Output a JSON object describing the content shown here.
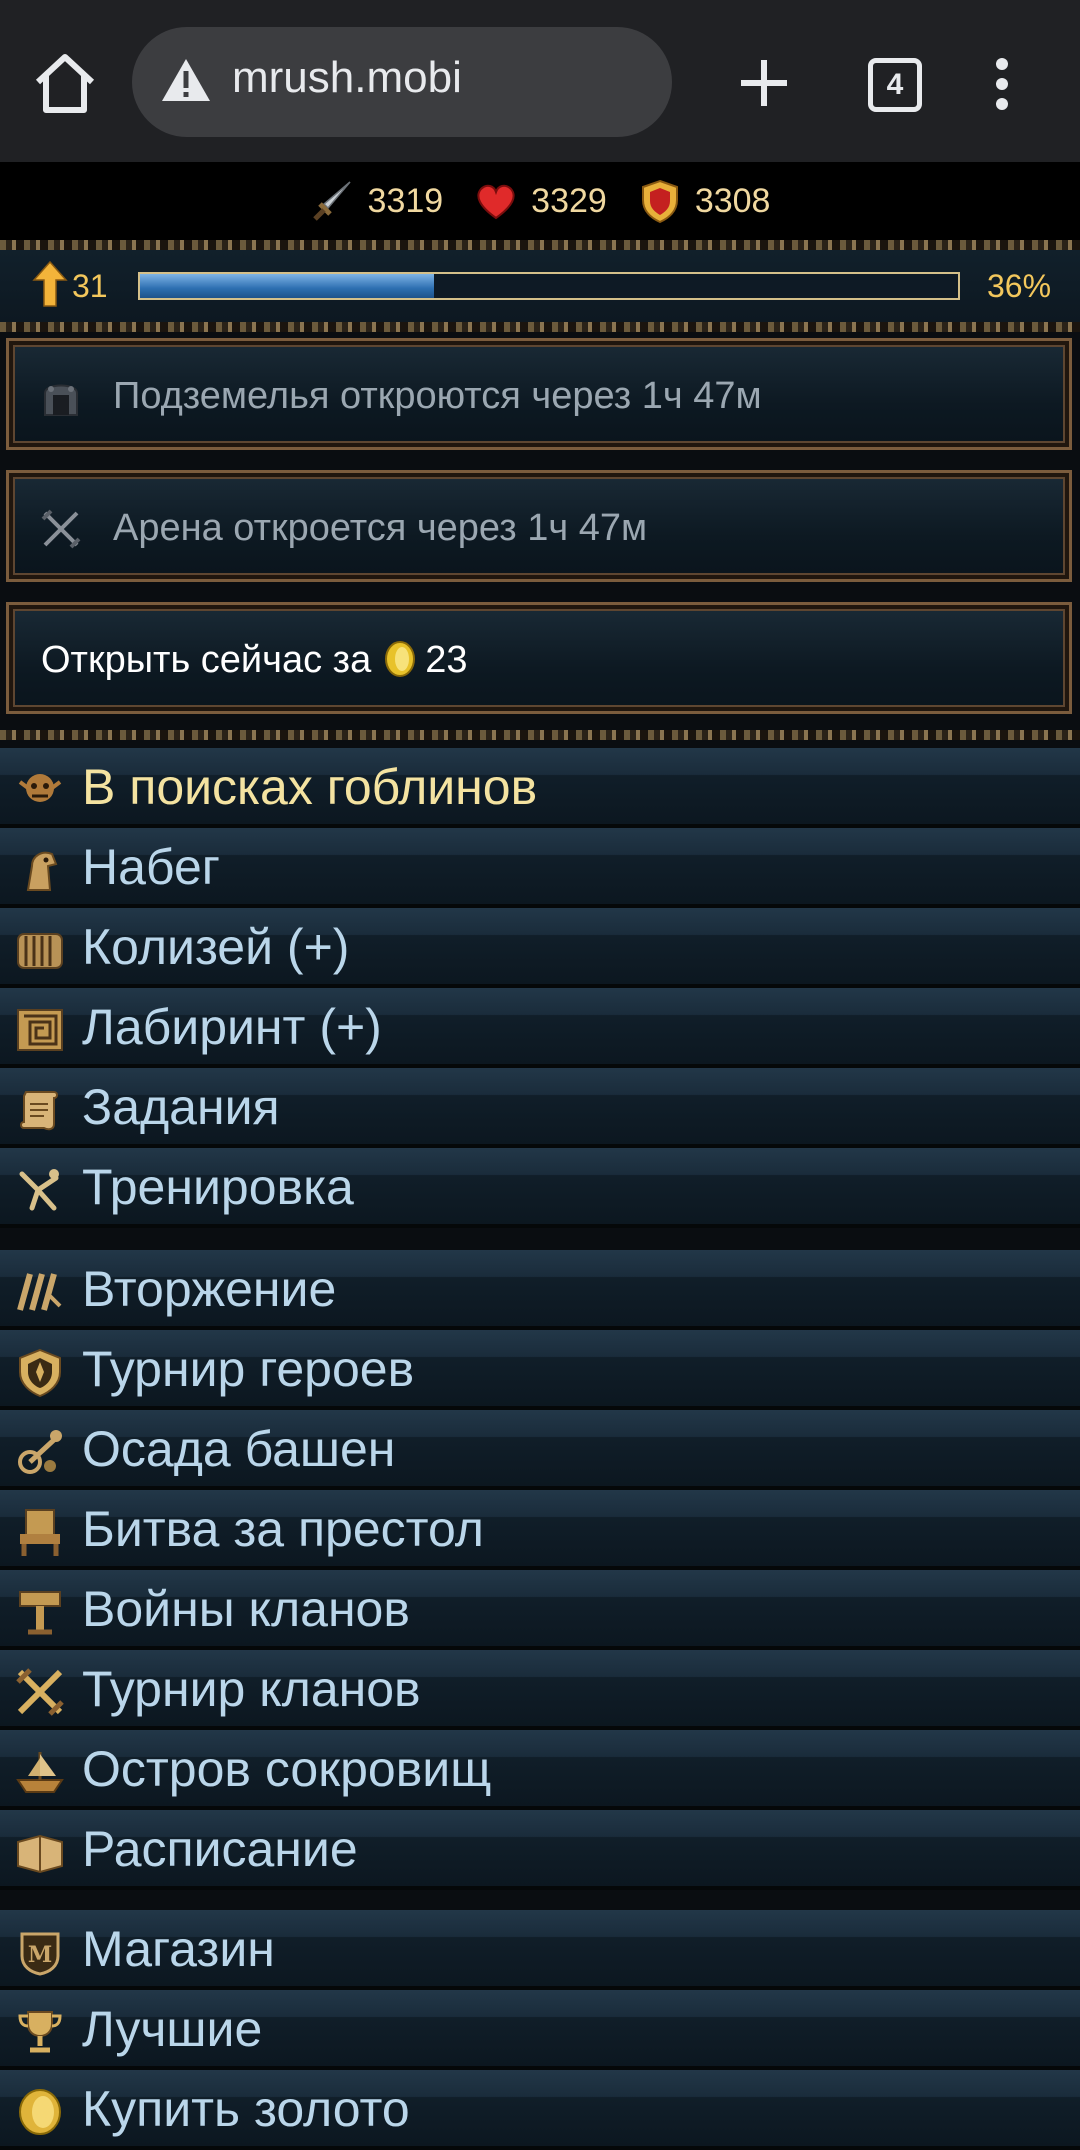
{
  "browser": {
    "url": "mrush.mobi",
    "tab_count": "4"
  },
  "stats": {
    "attack": "3319",
    "health": "3329",
    "defense": "3308"
  },
  "level": {
    "value": "31",
    "progress_percent_label": "36%",
    "progress": 0.36
  },
  "notices": {
    "dungeons": "Подземелья откроются через 1ч 47м",
    "arena": "Арена откроется через 1ч 47м",
    "open_now_label": "Открыть сейчас за",
    "open_now_price": "23"
  },
  "menu_group1": [
    {
      "label": "В поисках гоблинов",
      "icon": "goblin-icon"
    },
    {
      "label": "Набег",
      "icon": "horse-icon"
    },
    {
      "label": "Колизей (+)",
      "icon": "colosseum-icon"
    },
    {
      "label": "Лабиринт (+)",
      "icon": "labyrinth-icon"
    },
    {
      "label": "Задания",
      "icon": "scroll-icon"
    },
    {
      "label": "Тренировка",
      "icon": "training-icon"
    }
  ],
  "menu_group2": [
    {
      "label": "Вторжение",
      "icon": "invasion-icon"
    },
    {
      "label": "Турнир героев",
      "icon": "shield-icon"
    },
    {
      "label": "Осада башен",
      "icon": "siege-icon"
    },
    {
      "label": "Битва за престол",
      "icon": "throne-icon"
    },
    {
      "label": "Войны кланов",
      "icon": "clan-war-icon"
    },
    {
      "label": "Турнир кланов",
      "icon": "crossed-swords-icon"
    },
    {
      "label": "Остров сокровищ",
      "icon": "ship-icon"
    },
    {
      "label": "Расписание",
      "icon": "book-icon"
    }
  ],
  "menu_group3": [
    {
      "label": "Магазин",
      "icon": "shop-icon"
    },
    {
      "label": "Лучшие",
      "icon": "trophy-icon"
    },
    {
      "label": "Купить золото",
      "icon": "gold-coin-icon"
    }
  ],
  "colors": {
    "accent_gold": "#f3c75c",
    "menu_text": "#bad6ea",
    "highlight_text": "#f4e3a1"
  }
}
